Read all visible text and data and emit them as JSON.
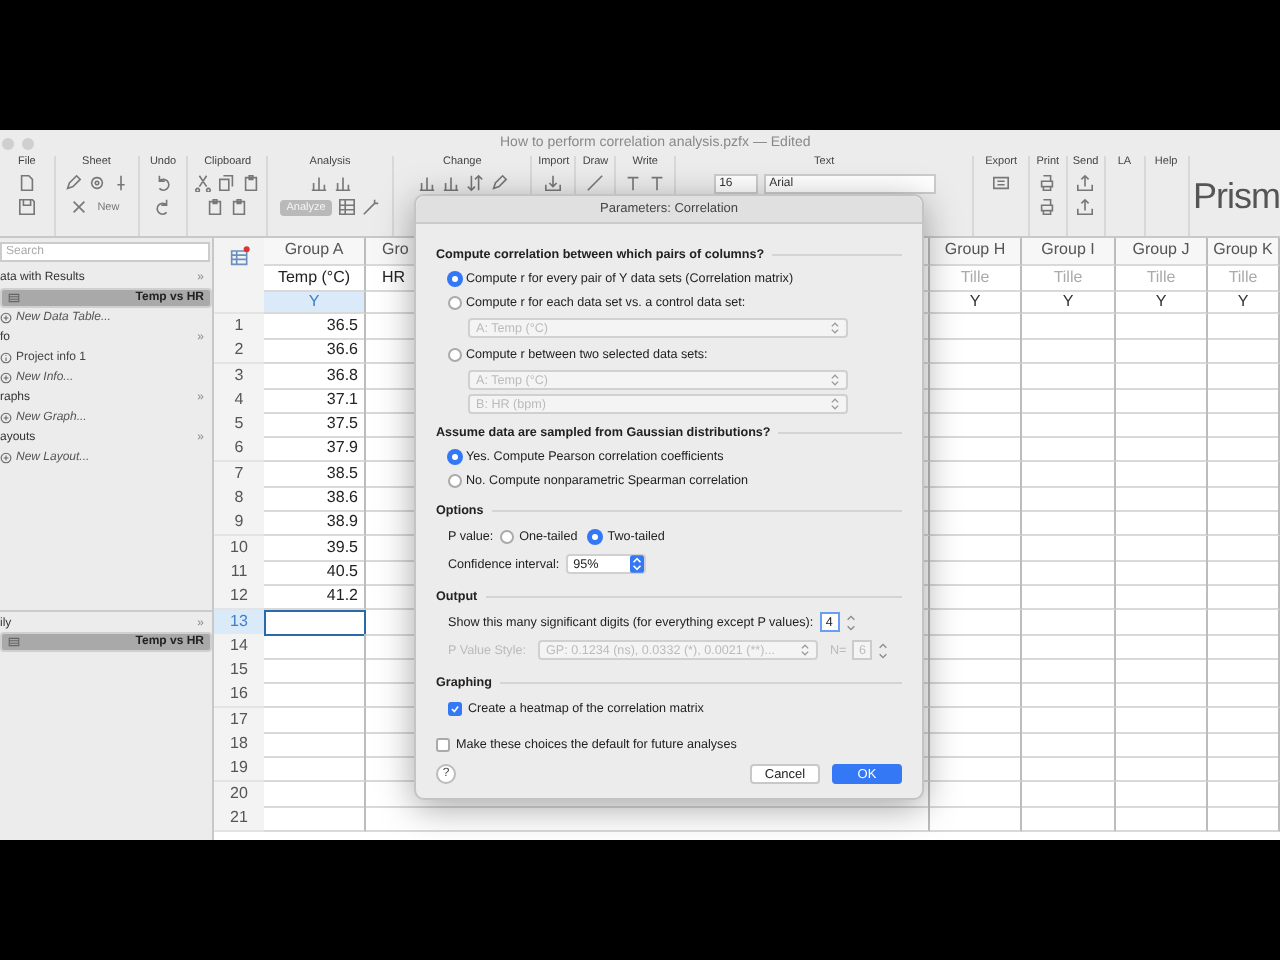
{
  "window": {
    "title": "How to perform correlation analysis.pzfx — Edited"
  },
  "toolbar": {
    "groups": [
      {
        "label": "File"
      },
      {
        "label": "Sheet",
        "button": "New"
      },
      {
        "label": "Undo"
      },
      {
        "label": "Clipboard"
      },
      {
        "label": "Analysis",
        "button": "Analyze"
      },
      {
        "label": "Change"
      },
      {
        "label": "Import"
      },
      {
        "label": "Draw"
      },
      {
        "label": "Write"
      },
      {
        "label": "Text",
        "size": "16",
        "font": "Arial"
      },
      {
        "label": "Export"
      },
      {
        "label": "Print"
      },
      {
        "label": "Send"
      },
      {
        "label": "LA"
      },
      {
        "label": "Help"
      }
    ],
    "brand": "Prism"
  },
  "sidebar": {
    "search": {
      "placeholder": "Search"
    },
    "sections": [
      {
        "title": "ata with Results",
        "toggle": "»",
        "items": [
          {
            "kind": "sheet",
            "label": "Temp vs HR",
            "selected": true
          },
          {
            "kind": "new",
            "label": "New Data Table...",
            "selected": false
          }
        ]
      },
      {
        "title": "fo",
        "toggle": "»",
        "items": [
          {
            "kind": "info",
            "label": "Project info 1",
            "selected": false
          },
          {
            "kind": "new",
            "label": "New Info...",
            "selected": false
          }
        ]
      },
      {
        "title": "raphs",
        "toggle": "»",
        "items": [
          {
            "kind": "new",
            "label": "New Graph...",
            "selected": false
          }
        ]
      },
      {
        "title": "ayouts",
        "toggle": "»",
        "items": [
          {
            "kind": "new",
            "label": "New Layout...",
            "selected": false
          }
        ]
      }
    ],
    "family": {
      "title": "ily",
      "toggle": "»",
      "items": [
        {
          "kind": "sheet",
          "label": "Temp vs HR",
          "selected": true
        }
      ]
    }
  },
  "sheet": {
    "columns": [
      {
        "group": "Group A",
        "title": "Temp (°C)",
        "subcolumn": "Y",
        "selected": true
      },
      {
        "group": "Gro",
        "title": "HR",
        "selected": false
      },
      {
        "group": "Group H",
        "title": "Tille",
        "subcolumn": "Y",
        "selected": false
      },
      {
        "group": "Group I",
        "title": "Tille",
        "subcolumn": "Y",
        "selected": false
      },
      {
        "group": "Group J",
        "title": "Tille",
        "subcolumn": "Y",
        "selected": false
      },
      {
        "group": "Group K",
        "title": "Tille",
        "subcolumn": "Y",
        "selected": false
      }
    ],
    "rows": [
      {
        "number": "1",
        "value": "36.5",
        "selected": false
      },
      {
        "number": "2",
        "value": "36.6",
        "selected": false
      },
      {
        "number": "3",
        "value": "36.8",
        "selected": false
      },
      {
        "number": "4",
        "value": "37.1",
        "selected": false
      },
      {
        "number": "5",
        "value": "37.5",
        "selected": false
      },
      {
        "number": "6",
        "value": "37.9",
        "selected": false
      },
      {
        "number": "7",
        "value": "38.5",
        "selected": false
      },
      {
        "number": "8",
        "value": "38.6",
        "selected": false
      },
      {
        "number": "9",
        "value": "38.9",
        "selected": false
      },
      {
        "number": "10",
        "value": "39.5",
        "selected": false
      },
      {
        "number": "11",
        "value": "40.5",
        "selected": false
      },
      {
        "number": "12",
        "value": "41.2",
        "selected": false
      },
      {
        "number": "13",
        "selected": true
      },
      {
        "number": "14",
        "selected": false
      },
      {
        "number": "15",
        "selected": false
      },
      {
        "number": "16",
        "selected": false
      },
      {
        "number": "17",
        "selected": false
      },
      {
        "number": "18",
        "selected": false
      },
      {
        "number": "19",
        "selected": false
      },
      {
        "number": "20",
        "selected": false
      },
      {
        "number": "21",
        "selected": false
      }
    ]
  },
  "dialog": {
    "title": "Parameters: Correlation",
    "pairs": {
      "heading": "Compute correlation between which pairs of columns?",
      "options": [
        {
          "label": "Compute r for every pair of Y data sets (Correlation matrix)",
          "selected": true
        },
        {
          "label": "Compute r for each data set vs. a control data set:",
          "selected": false,
          "selects": [
            {
              "value": "A: Temp (°C)",
              "disabled": true
            }
          ]
        },
        {
          "label": "Compute r between two selected data sets:",
          "selected": false,
          "selects": [
            {
              "value": "A: Temp (°C)",
              "disabled": true
            },
            {
              "value": "B: HR (bpm)",
              "disabled": true
            }
          ]
        }
      ]
    },
    "gaussian": {
      "heading": "Assume data are sampled from Gaussian distributions?",
      "options": [
        {
          "label": "Yes. Compute Pearson correlation coefficients",
          "selected": true
        },
        {
          "label": "No. Compute nonparametric Spearman correlation",
          "selected": false
        }
      ]
    },
    "options": {
      "heading": "Options",
      "p_value_label": "P value:",
      "tails": [
        {
          "label": "One-tailed",
          "selected": false
        },
        {
          "label": "Two-tailed",
          "selected": true
        }
      ],
      "confidence_label": "Confidence interval:",
      "confidence": "95%"
    },
    "output": {
      "heading": "Output",
      "digits_label": "Show this many significant digits (for everything except P values):",
      "digits": "4",
      "style_label": "P Value Style:",
      "style": "GP: 0.1234 (ns), 0.0332 (*), 0.0021 (**)...",
      "n_label": "N=",
      "n": "6",
      "disabled": true
    },
    "graphing": {
      "heading": "Graphing",
      "heatmap": {
        "label": "Create a heatmap of the correlation matrix",
        "checked": true
      }
    },
    "default_choice": {
      "label": "Make these choices the default for future analyses",
      "checked": false
    },
    "help": "?",
    "buttons": [
      {
        "label": "Cancel",
        "default": false
      },
      {
        "label": "OK",
        "default": true
      }
    ]
  }
}
